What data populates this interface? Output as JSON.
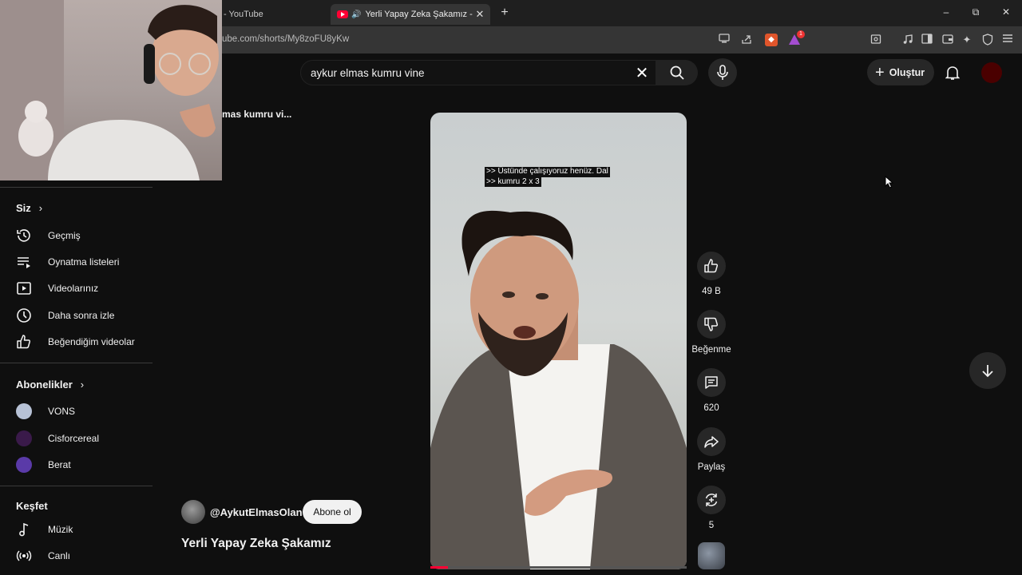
{
  "browser": {
    "tabs": [
      {
        "title": "- YouTube",
        "active": false
      },
      {
        "title": "Yerli Yapay Zeka Şakamız - Yo",
        "active": true
      }
    ],
    "new_tab": "+",
    "url": "ube.com/shorts/My8zoFU8yKw",
    "notification_badge": "1",
    "window_controls": {
      "minimize": "–",
      "restore": "⧉",
      "close": "✕"
    }
  },
  "masthead": {
    "search_value": "aykur elmas kumru vine",
    "clear_glyph": "✕",
    "create_label": "Oluştur",
    "create_plus": "+"
  },
  "sidebar": {
    "partial_title": "mas kumru vi...",
    "you_section": {
      "title": "Siz",
      "chevron": "›",
      "items": [
        {
          "label": "Geçmiş",
          "icon": "history-icon"
        },
        {
          "label": "Oynatma listeleri",
          "icon": "playlists-icon"
        },
        {
          "label": "Videolarınız",
          "icon": "your-videos-icon"
        },
        {
          "label": "Daha sonra izle",
          "icon": "watch-later-icon"
        },
        {
          "label": "Beğendiğim videolar",
          "icon": "liked-videos-icon"
        }
      ]
    },
    "subscriptions": {
      "title": "Abonelikler",
      "chevron": "›",
      "items": [
        {
          "label": "VONS",
          "color": "#b7c2d6"
        },
        {
          "label": "Cisforcereal",
          "color": "#3a1a4a"
        },
        {
          "label": "Berat",
          "color": "#5a3aa8"
        }
      ]
    },
    "explore": {
      "title": "Keşfet",
      "items": [
        {
          "label": "Müzik",
          "icon": "music-note-icon"
        },
        {
          "label": "Canlı",
          "icon": "live-icon"
        }
      ]
    }
  },
  "short": {
    "caption_lines": [
      ">> Üstünde çalışıyoruz henüz. Dal",
      ">> kumru 2 x 3"
    ],
    "channel": "@AykutElmasOlan",
    "subscribe_label": "Abone ol",
    "title": "Yerli Yapay Zeka Şakamız",
    "progress": 0.07,
    "actions": {
      "likes": "49 B",
      "dislike_label": "Beğenme",
      "comments": "620",
      "share_label": "Paylaş",
      "remix_count": "5"
    }
  },
  "colors": {
    "accent_red": "#ff0033",
    "background": "#0f0f0f",
    "button_bg": "#272727"
  }
}
